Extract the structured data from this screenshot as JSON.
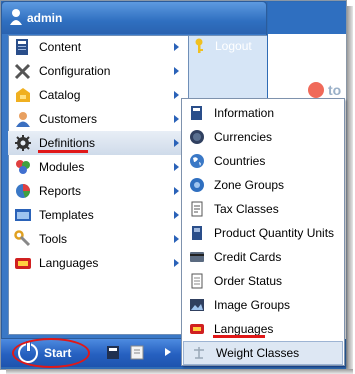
{
  "user": {
    "name": "admin"
  },
  "start_menu": {
    "items": [
      {
        "label": "Content",
        "icon": "content-icon",
        "has_submenu": true
      },
      {
        "label": "Configuration",
        "icon": "configuration-icon",
        "has_submenu": true
      },
      {
        "label": "Catalog",
        "icon": "catalog-icon",
        "has_submenu": true
      },
      {
        "label": "Customers",
        "icon": "customers-icon",
        "has_submenu": true
      },
      {
        "label": "Definitions",
        "icon": "definitions-icon",
        "has_submenu": true,
        "active": true
      },
      {
        "label": "Modules",
        "icon": "modules-icon",
        "has_submenu": true
      },
      {
        "label": "Reports",
        "icon": "reports-icon",
        "has_submenu": true
      },
      {
        "label": "Templates",
        "icon": "templates-icon",
        "has_submenu": true
      },
      {
        "label": "Tools",
        "icon": "tools-icon",
        "has_submenu": true
      },
      {
        "label": "Languages",
        "icon": "languages-icon",
        "has_submenu": true
      }
    ],
    "logout_label": "Logout"
  },
  "taskbar": {
    "start_label": "Start"
  },
  "background_app": {
    "text_fragment": "to"
  },
  "definitions_submenu": {
    "items": [
      {
        "label": "Information",
        "icon": "information-icon"
      },
      {
        "label": "Currencies",
        "icon": "currencies-icon"
      },
      {
        "label": "Countries",
        "icon": "countries-icon"
      },
      {
        "label": "Zone Groups",
        "icon": "zone-groups-icon"
      },
      {
        "label": "Tax Classes",
        "icon": "tax-classes-icon"
      },
      {
        "label": "Product Quantity Units",
        "icon": "product-quantity-units-icon"
      },
      {
        "label": "Credit Cards",
        "icon": "credit-cards-icon"
      },
      {
        "label": "Order Status",
        "icon": "order-status-icon"
      },
      {
        "label": "Image Groups",
        "icon": "image-groups-icon"
      },
      {
        "label": "Languages",
        "icon": "languages-icon"
      },
      {
        "label": "Weight Classes",
        "icon": "weight-classes-icon",
        "highlighted": true
      }
    ]
  },
  "colors": {
    "accent_blue": "#2e6bb5",
    "highlight_red": "#e01818",
    "menu_hover": "#dde7f3"
  }
}
